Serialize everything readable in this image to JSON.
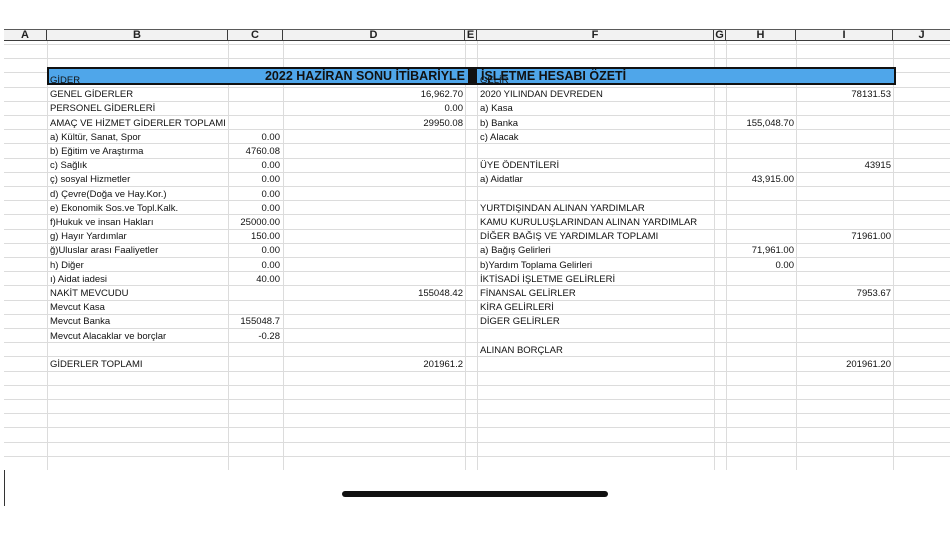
{
  "columns": [
    "A",
    "B",
    "C",
    "D",
    "E",
    "F",
    "G",
    "H",
    "I",
    "J"
  ],
  "title": {
    "left": "2022 HAZİRAN SONU İTİBARİYLE",
    "right": "İŞLETME HESABI ÖZETİ"
  },
  "gider": {
    "header": "GİDER",
    "rows": [
      {
        "label": "GENEL GİDERLER",
        "detail": "",
        "total": "16,962.70"
      },
      {
        "label": "PERSONEL GİDERLERİ",
        "detail": "",
        "total": "0.00"
      },
      {
        "label": "AMAÇ VE HİZMET GİDERLER TOPLAMI",
        "detail": "",
        "total": "29950.08"
      },
      {
        "label": "a) Kültür, Sanat, Spor",
        "detail": "0.00",
        "total": ""
      },
      {
        "label": "b) Eğitim ve Araştırma",
        "detail": "4760.08",
        "total": ""
      },
      {
        "label": "c) Sağlık",
        "detail": "0.00",
        "total": ""
      },
      {
        "label": "ç) sosyal Hizmetler",
        "detail": "0.00",
        "total": ""
      },
      {
        "label": "d) Çevre(Doğa ve Hay.Kor.)",
        "detail": "0.00",
        "total": ""
      },
      {
        "label": "e) Ekonomik Sos.ve Topl.Kalk.",
        "detail": "0.00",
        "total": ""
      },
      {
        "label": "f)Hukuk ve insan Hakları",
        "detail": "25000.00",
        "total": ""
      },
      {
        "label": "g) Hayır Yardımlar",
        "detail": "150.00",
        "total": ""
      },
      {
        "label": "ğ)Uluslar arası Faaliyetler",
        "detail": "0.00",
        "total": ""
      },
      {
        "label": "h) Diğer",
        "detail": "0.00",
        "total": ""
      },
      {
        "label": "ı) Aidat iadesi",
        "detail": "40.00",
        "total": ""
      },
      {
        "label": "NAKİT MEVCUDU",
        "detail": "",
        "total": "155048.42"
      },
      {
        "label": "Mevcut Kasa",
        "detail": "",
        "total": ""
      },
      {
        "label": "Mevcut Banka",
        "detail": "155048.7",
        "total": ""
      },
      {
        "label": "Mevcut Alacaklar ve borçlar",
        "detail": "-0.28",
        "total": ""
      },
      {
        "label": "",
        "detail": "",
        "total": ""
      },
      {
        "label": "GİDERLER TOPLAMI",
        "detail": "",
        "total": "201961.2"
      }
    ]
  },
  "gelir": {
    "header": "GELİR",
    "rows": [
      {
        "label": "2020 YILINDAN DEVREDEN",
        "detail": "",
        "total": "78131.53"
      },
      {
        "label": "a) Kasa",
        "detail": "",
        "total": ""
      },
      {
        "label": "b) Banka",
        "detail": "155,048.70",
        "total": ""
      },
      {
        "label": "c) Alacak",
        "detail": "",
        "total": ""
      },
      {
        "label": "",
        "detail": "",
        "total": ""
      },
      {
        "label": "ÜYE ÖDENTİLERİ",
        "detail": "",
        "total": "43915"
      },
      {
        "label": "a) Aidatlar",
        "detail": "43,915.00",
        "total": ""
      },
      {
        "label": "",
        "detail": "",
        "total": ""
      },
      {
        "label": "YURTDIŞINDAN ALINAN YARDIMLAR",
        "detail": "",
        "total": ""
      },
      {
        "label": "KAMU KURULUŞLARINDAN ALINAN YARDIMLAR",
        "detail": "",
        "total": ""
      },
      {
        "label": "DİĞER BAĞIŞ VE YARDIMLAR TOPLAMI",
        "detail": "",
        "total": "71961.00"
      },
      {
        "label": "a) Bağış Gelirleri",
        "detail": "71,961.00",
        "total": ""
      },
      {
        "label": "b)Yardım Toplama Gelirleri",
        "detail": "0.00",
        "total": ""
      },
      {
        "label": "İKTİSADİ İŞLETME GELİRLERİ",
        "detail": "",
        "total": ""
      },
      {
        "label": "FİNANSAL GELİRLER",
        "detail": "",
        "total": "7953.67"
      },
      {
        "label": "KİRA GELİRLERİ",
        "detail": "",
        "total": ""
      },
      {
        "label": "DİGER GELİRLER",
        "detail": "",
        "total": ""
      },
      {
        "label": "",
        "detail": "",
        "total": ""
      },
      {
        "label": "ALINAN BORÇLAR",
        "detail": "",
        "total": ""
      },
      {
        "label": "",
        "detail": "",
        "total": "201961.20"
      }
    ]
  }
}
